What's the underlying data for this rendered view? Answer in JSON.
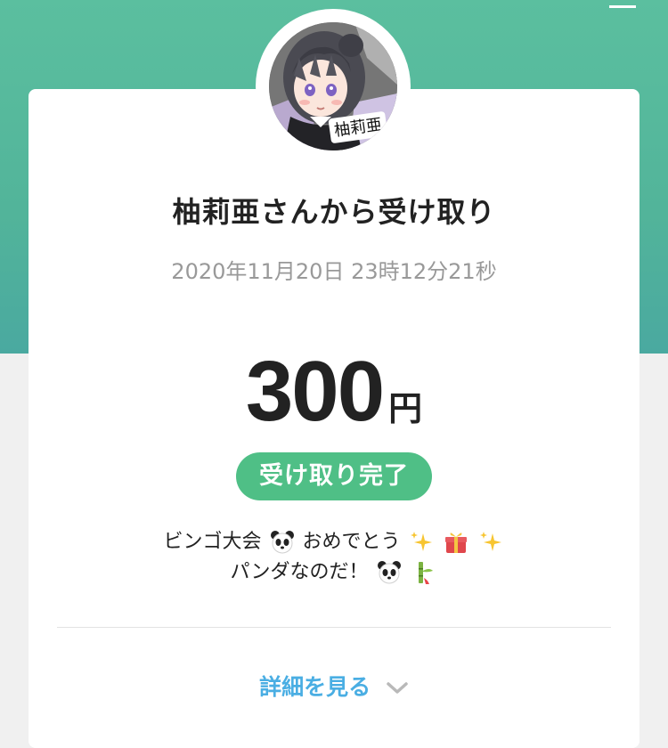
{
  "header": {
    "menu_icon": "hamburger-menu-icon",
    "band_color": "#55b89d"
  },
  "card": {
    "avatar_caption": "柚莉亜",
    "title": "柚莉亜さんから受け取り",
    "datetime": "2020年11月20日 23時12分21秒",
    "amount": "300",
    "currency": "円",
    "status": "受け取り完了",
    "status_color": "#4fbf86",
    "message_line1_a": "ビンゴ大会",
    "message_line1_b": "おめでとう",
    "message_line2": "パンダなのだ！",
    "message_emoji": [
      "panda-emoji",
      "sparkles-emoji",
      "gift-emoji",
      "sparkles-emoji",
      "panda-emoji",
      "bamboo-emoji"
    ],
    "details_label": "詳細を見る",
    "link_color": "#4aaee3"
  }
}
